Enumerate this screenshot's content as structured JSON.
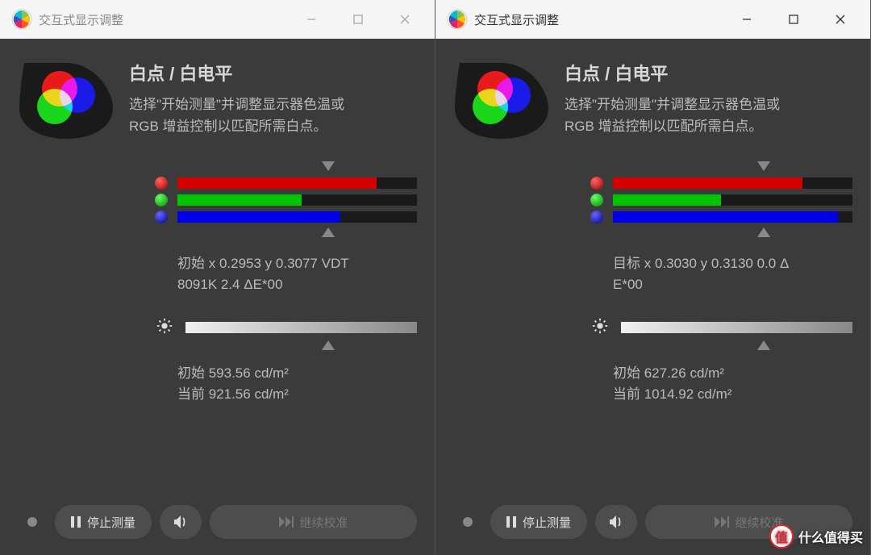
{
  "left": {
    "title": "交互式显示调整",
    "heading": "白点 / 白电平",
    "desc_line1": "选择\"开始测量\"并调整显示器色温或",
    "desc_line2": "RGB 增益控制以匹配所需白点。",
    "bars": {
      "marker_top_pct": 63,
      "marker_bottom_pct": 63,
      "red_pct": 83,
      "green_pct": 52,
      "blue_pct": 68
    },
    "info_line1": "初始 x 0.2953 y 0.3077 VDT",
    "info_line2": "8091K 2.4 ΔE*00",
    "brightness": {
      "fill_pct": 100,
      "marker_pct": 63,
      "line1": "初始 593.56 cd/m²",
      "line2": "当前 921.56 cd/m²"
    },
    "buttons": {
      "stop": "停止测量",
      "continue": "继续校准"
    }
  },
  "right": {
    "title": "交互式显示调整",
    "heading": "白点 / 白电平",
    "desc_line1": "选择\"开始测量\"并调整显示器色温或",
    "desc_line2": "RGB 增益控制以匹配所需白点。",
    "bars": {
      "marker_top_pct": 63,
      "marker_bottom_pct": 63,
      "red_pct": 79,
      "green_pct": 45,
      "blue_pct": 94
    },
    "info_line1": "目标 x 0.3030 y 0.3130 0.0 Δ",
    "info_line2": "E*00",
    "brightness": {
      "fill_pct": 100,
      "marker_pct": 63,
      "line1": "初始 627.26 cd/m²",
      "line2": "当前 1014.92 cd/m²"
    },
    "buttons": {
      "stop": "停止测量",
      "continue": "继续校准"
    }
  },
  "watermark": "什么值得买",
  "watermark_badge": "值",
  "colors": {
    "red": "#d40000",
    "green": "#00c400",
    "blue": "#0000e8"
  }
}
